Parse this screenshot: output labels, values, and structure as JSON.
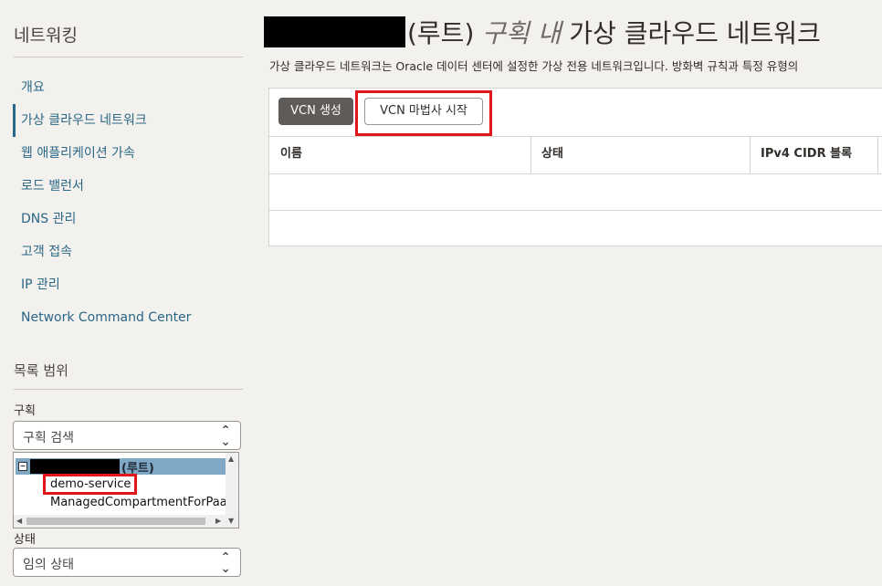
{
  "sidebar": {
    "title": "네트워킹",
    "items": [
      {
        "label": "개요"
      },
      {
        "label": "가상 클라우드 네트워크"
      },
      {
        "label": "웹 애플리케이션 가속"
      },
      {
        "label": "로드 밸런서"
      },
      {
        "label": "DNS 관리"
      },
      {
        "label": "고객 접속"
      },
      {
        "label": "IP 관리"
      },
      {
        "label": "Network Command Center"
      }
    ],
    "active_index": 1
  },
  "scope": {
    "title": "목록 범위",
    "compartment_label": "구획",
    "compartment_search_placeholder": "구획 검색",
    "tree": {
      "root_label": "(루트)",
      "children": [
        "demo-service",
        "ManagedCompartmentForPaaS"
      ]
    },
    "state_label": "상태",
    "state_value": "임의 상태"
  },
  "header": {
    "root_suffix": "(루트)",
    "title_italic": "구획 내",
    "title_rest": "가상 클라우드 네트워크",
    "subtitle": "가상 클라우드 네트워크는 Oracle 데이터 센터에 설정한 가상 전용 네트워크입니다. 방화벽 규칙과 특정 유형의"
  },
  "toolbar": {
    "create_vcn_label": "VCN 생성",
    "start_wizard_label": "VCN 마법사 시작"
  },
  "table": {
    "columns": [
      "이름",
      "상태",
      "IPv4 CIDR 블록"
    ]
  },
  "colors": {
    "highlight": "#e0161b",
    "link": "#2b6786",
    "primary_button": "#5f5b58"
  }
}
